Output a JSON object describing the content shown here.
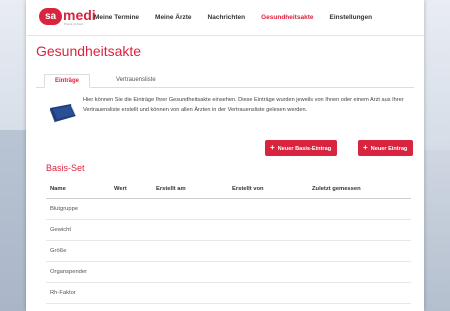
{
  "logo": {
    "left": "sa",
    "right": "medi",
    "tagline": "Praxis im Netz"
  },
  "nav": {
    "items": [
      {
        "label": "Meine Termine",
        "active": false
      },
      {
        "label": "Meine Ärzte",
        "active": false
      },
      {
        "label": "Nachrichten",
        "active": false
      },
      {
        "label": "Gesundheitsakte",
        "active": true
      },
      {
        "label": "Einstellungen",
        "active": false
      }
    ]
  },
  "page": {
    "title": "Gesundheitsakte"
  },
  "tabs": [
    {
      "label": "Einträge",
      "active": true
    },
    {
      "label": "Vertrauensliste",
      "active": false
    }
  ],
  "info": {
    "text": "Hier können Sie die Einträge Ihrer Gesundheitsakte einsehen. Diese Einträge wurden jeweils von Ihnen oder einem Arzt aus Ihrer Vertrauensliste erstellt und können von allen Ärzten in der Vertrauensliste gelesen werden."
  },
  "buttons": {
    "new_basis": "Neuer Basis-Eintrag",
    "new_entry": "Neuer Eintrag"
  },
  "section": {
    "title": "Basis-Set"
  },
  "table": {
    "headers": [
      "Name",
      "Wert",
      "Erstellt am",
      "Erstellt von",
      "Zuletzt gemessen"
    ],
    "rows": [
      {
        "name": "Blutgruppe"
      },
      {
        "name": "Gewicht"
      },
      {
        "name": "Größe"
      },
      {
        "name": "Organspender"
      },
      {
        "name": "Rh-Faktor"
      }
    ]
  },
  "colors": {
    "accent": "#d9243f"
  }
}
